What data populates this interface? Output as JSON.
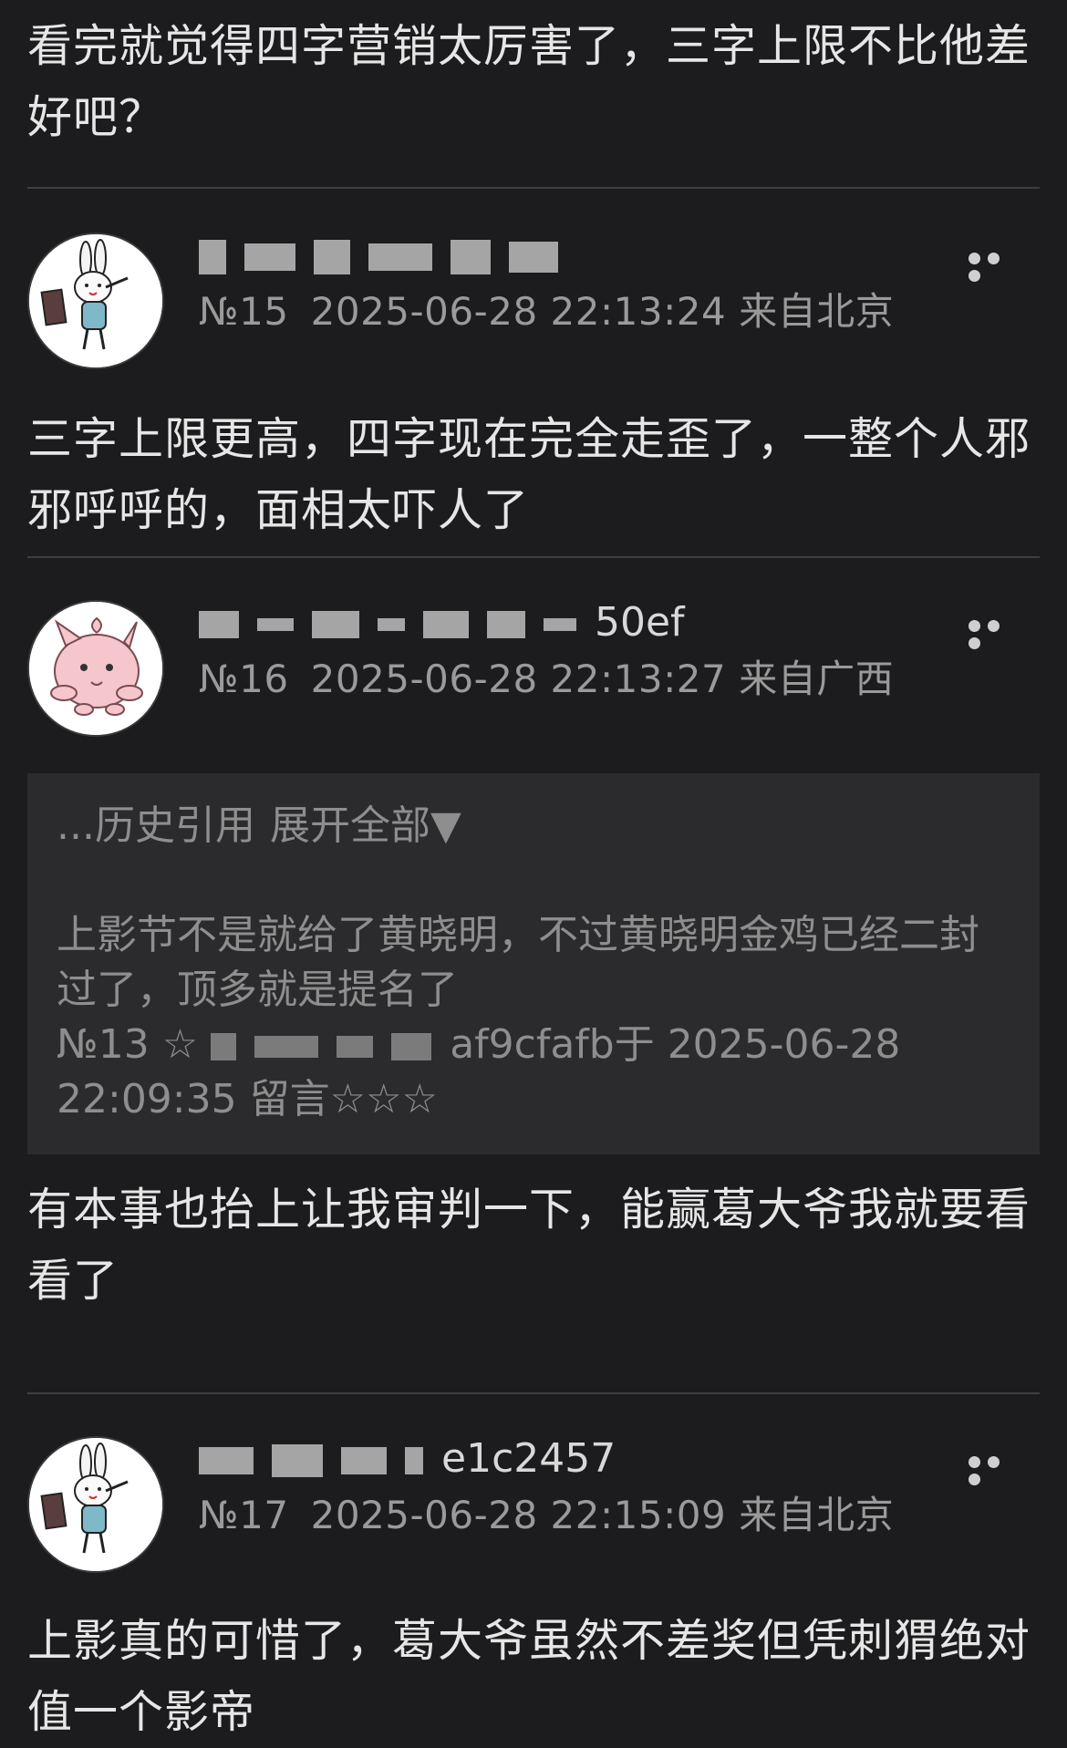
{
  "intro_comment": {
    "text": "看完就觉得四字营销太厉害了，三字上限不比他差好吧？"
  },
  "posts": [
    {
      "username_visible": "",
      "floor": "№15",
      "datetime": "2025-06-28 22:13:24",
      "location": "来自北京",
      "avatar_icon": "rabbit-avatar-icon",
      "content": "三字上限更高，四字现在完全走歪了，一整个人邪邪呼呼的，面相太吓人了"
    },
    {
      "username_visible": "50ef",
      "floor": "№16",
      "datetime": "2025-06-28 22:13:27",
      "location": "来自广西",
      "avatar_icon": "pink-creature-avatar-icon",
      "quote": {
        "history_label": "...历史引用",
        "expand_label": "展开全部▼",
        "text": "上影节不是就给了黄晓明，不过黄晓明金鸡已经二封过了，顶多就是提名了",
        "ref_floor": "№13 ☆",
        "ref_user_visible": "af9cfafb",
        "ref_time": "于 2025-06-28 22:09:35 留言☆☆☆"
      },
      "content": "有本事也抬上让我审判一下，能赢葛大爷我就要看看了"
    },
    {
      "username_visible": "e1c2457",
      "floor": "№17",
      "datetime": "2025-06-28 22:15:09",
      "location": "来自北京",
      "avatar_icon": "rabbit-avatar-icon",
      "content": "上影真的可惜了，葛大爷虽然不差奖但凭刺猬绝对值一个影帝"
    }
  ],
  "colors": {
    "background": "#1c1c1e",
    "text": "#e6e6e6",
    "meta": "#9a9a9a",
    "quote_bg": "#2b2b2d",
    "divider": "#3e3e42"
  }
}
